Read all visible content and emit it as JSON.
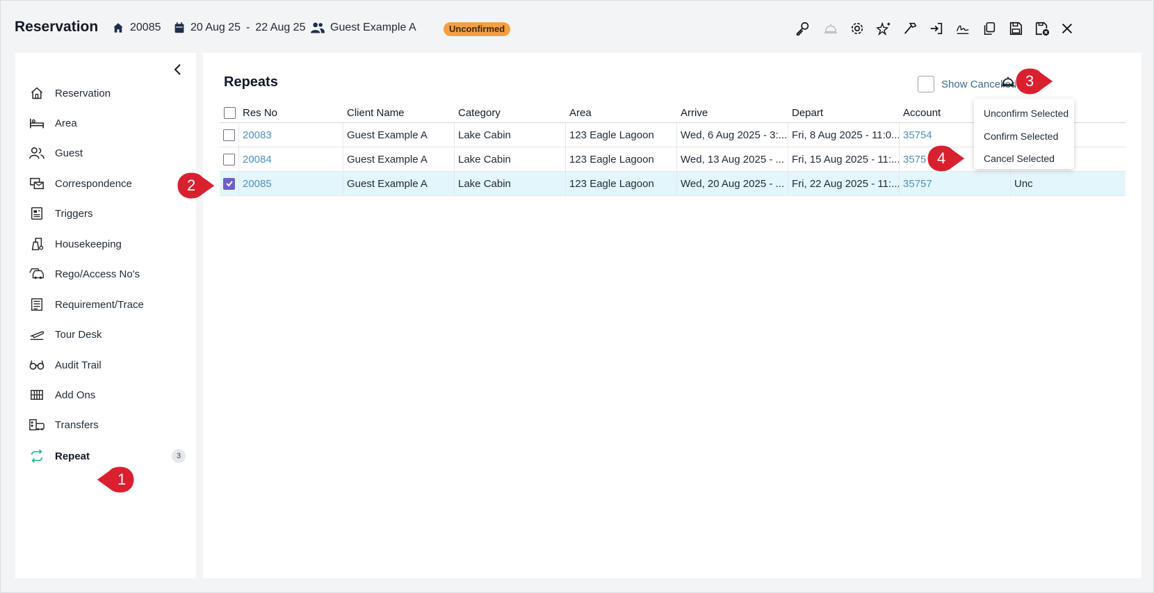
{
  "header": {
    "title": "Reservation",
    "res_no": "20085",
    "date_from": "20 Aug 25",
    "date_sep": "-",
    "date_to": "22 Aug 25",
    "guest": "Guest Example A",
    "status": "Unconfirmed"
  },
  "toolbar_icons": [
    "key-icon",
    "service-bell-icon",
    "gear-icon",
    "sparkle-star-icon",
    "hammer-icon",
    "check-in-icon",
    "signature-icon",
    "copy-icon",
    "save-icon",
    "save-close-icon",
    "close-icon"
  ],
  "sidebar": {
    "items": [
      {
        "label": "Reservation",
        "icon": "home-icon"
      },
      {
        "label": "Area",
        "icon": "bed-icon"
      },
      {
        "label": "Guest",
        "icon": "users-icon"
      },
      {
        "label": "Correspondence",
        "icon": "correspondence-icon"
      },
      {
        "label": "Triggers",
        "icon": "triggers-icon"
      },
      {
        "label": "Housekeeping",
        "icon": "housekeeping-icon"
      },
      {
        "label": "Rego/Access No's",
        "icon": "car-icon"
      },
      {
        "label": "Requirement/Trace",
        "icon": "list-icon"
      },
      {
        "label": "Tour Desk",
        "icon": "plane-icon"
      },
      {
        "label": "Audit Trail",
        "icon": "glasses-icon"
      },
      {
        "label": "Add Ons",
        "icon": "grid-icon"
      },
      {
        "label": "Transfers",
        "icon": "bus-icon"
      },
      {
        "label": "Repeat",
        "icon": "repeat-icon",
        "count": "3"
      }
    ]
  },
  "main": {
    "title": "Repeats",
    "show_cancelled": "Show Cancelled",
    "columns": [
      "Res No",
      "Client Name",
      "Category",
      "Area",
      "Arrive",
      "Depart",
      "Account"
    ],
    "rows": [
      {
        "res_no": "20083",
        "client": "Guest Example A",
        "category": "Lake Cabin",
        "area": "123 Eagle Lagoon",
        "arrive": "Wed, 6 Aug 2025 - 3:...",
        "depart": "Fri, 8 Aug 2025 - 11:0...",
        "account": "35754",
        "status": "",
        "checked": false
      },
      {
        "res_no": "20084",
        "client": "Guest Example A",
        "category": "Lake Cabin",
        "area": "123 Eagle Lagoon",
        "arrive": "Wed, 13 Aug 2025 - ...",
        "depart": "Fri, 15 Aug 2025 - 11:...",
        "account": "3575",
        "status": "",
        "checked": false
      },
      {
        "res_no": "20085",
        "client": "Guest Example A",
        "category": "Lake Cabin",
        "area": "123 Eagle Lagoon",
        "arrive": "Wed, 20 Aug 2025 - ...",
        "depart": "Fri, 22 Aug 2025 - 11:...",
        "account": "35757",
        "status": "Unc",
        "checked": true
      }
    ]
  },
  "dropdown": {
    "items": [
      "Unconfirm Selected",
      "Confirm Selected",
      "Cancel Selected"
    ]
  },
  "callouts": [
    "1",
    "2",
    "3",
    "4"
  ],
  "colors": {
    "accent": "#6e5fc8",
    "link": "#4f8fbf",
    "badge": "#f59e42",
    "callout": "#d9202f",
    "selected_row": "#e3f6fb"
  }
}
